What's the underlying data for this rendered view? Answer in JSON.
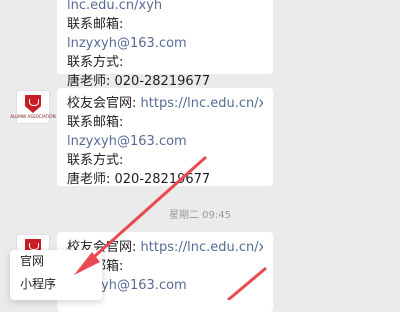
{
  "messages": [
    {
      "lines": [
        {
          "label": "",
          "value": ""
        },
        {
          "label": "联系邮箱:",
          "value": ""
        },
        {
          "label": "",
          "value": "lnzyxyh@163.com"
        },
        {
          "label": "联系方式:",
          "value": ""
        },
        {
          "label": "唐老师:  020-28219677",
          "value": ""
        }
      ]
    },
    {
      "lines": [
        {
          "label": "校友会官网:  ",
          "value": "https://lnc.edu.cn/xyh"
        },
        {
          "label": "联系邮箱:",
          "value": ""
        },
        {
          "label": "",
          "value": "lnzyxyh@163.com"
        },
        {
          "label": "联系方式:",
          "value": ""
        },
        {
          "label": "唐老师:  020-28219677",
          "value": ""
        }
      ]
    },
    {
      "lines": [
        {
          "label": "校友会官网:  ",
          "value": "https://lnc.edu.cn/xyh"
        },
        {
          "label": "联系邮箱:",
          "value": ""
        },
        {
          "label": "",
          "value": "lnzyxyh@163.com"
        }
      ]
    }
  ],
  "timestamp": "星期二 09:45",
  "avatar": {
    "org_text": "ALUMNI ASSOCIATION"
  },
  "popup_menu": {
    "items": [
      "官网",
      "小程序"
    ]
  },
  "colors": {
    "link": "#576b95",
    "arrow": "#e94a4f",
    "logo": "#c81d25"
  }
}
